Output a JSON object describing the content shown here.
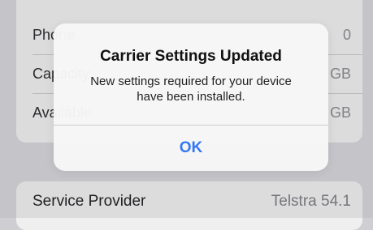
{
  "settings": {
    "rows": [
      {
        "label": "Phone",
        "value": "0"
      },
      {
        "label": "Capacity",
        "value": "GB"
      },
      {
        "label": "Available",
        "value": "GB"
      }
    ],
    "service_provider": {
      "label": "Service Provider",
      "value": "Telstra 54.1"
    }
  },
  "alert": {
    "title": "Carrier Settings Updated",
    "message": "New settings required for your device\nhave been installed.",
    "ok_label": "OK"
  },
  "colors": {
    "accent": "#3478f6",
    "background": "#d4d4d9",
    "group": "#efefef"
  }
}
